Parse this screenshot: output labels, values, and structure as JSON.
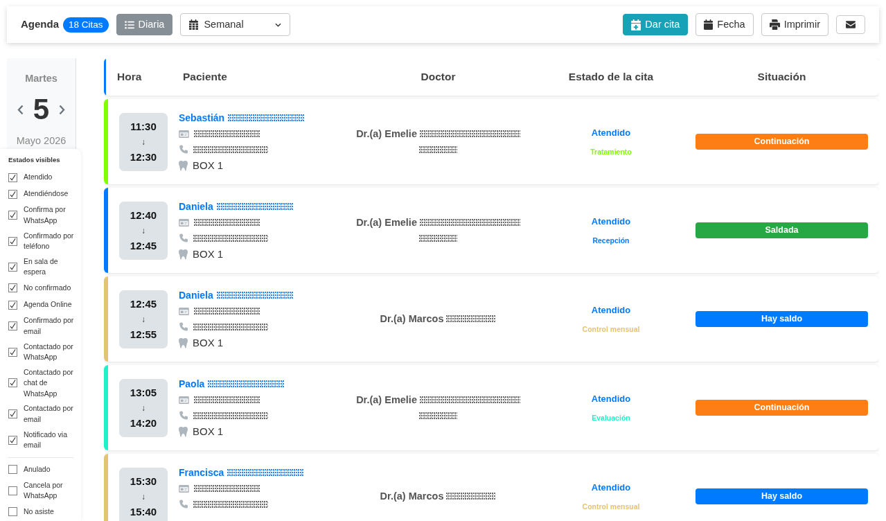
{
  "toolbar": {
    "title": "Agenda",
    "count_badge": "18 Citas",
    "view_button": {
      "label": "Diaria",
      "selected": true
    },
    "view_select": {
      "value": "Semanal"
    },
    "actions": [
      {
        "kind": "add",
        "label": "Dar cita"
      },
      {
        "kind": "date",
        "label": "Fecha"
      },
      {
        "kind": "print",
        "label": "Imprimir"
      },
      {
        "kind": "mail"
      }
    ]
  },
  "date_picker": {
    "weekday": "Martes",
    "day": "5",
    "month_year": "Mayo 2026"
  },
  "status_filter": {
    "title": "Estados visibles",
    "groups": [
      {
        "items": [
          {
            "label": "Atendido",
            "checked": true
          },
          {
            "label": "Atendiéndose",
            "checked": true
          },
          {
            "label": "Confirma por WhatsApp",
            "checked": true
          },
          {
            "label": "Confirmado por teléfono",
            "checked": true
          },
          {
            "label": "En sala de espera",
            "checked": true
          },
          {
            "label": "No confirmado",
            "checked": true
          },
          {
            "label": "Agenda Online",
            "checked": true
          },
          {
            "label": "Confirmado por email",
            "checked": true
          },
          {
            "label": "Contactado por WhatsApp",
            "checked": true
          },
          {
            "label": "Contactado por chat de WhatsApp",
            "checked": true
          },
          {
            "label": "Contactado por email",
            "checked": true
          },
          {
            "label": "Notificado via email",
            "checked": true
          }
        ]
      },
      {
        "items": [
          {
            "label": "Anulado",
            "checked": false
          },
          {
            "label": "Cancela por WhatsApp",
            "checked": false
          },
          {
            "label": "No asiste",
            "checked": false
          }
        ]
      }
    ]
  },
  "table": {
    "columns": [
      "Hora",
      "Paciente",
      "Doctor",
      "Estado de la cita",
      "Situación"
    ],
    "rows": [
      {
        "color": "#7fff00",
        "start": "11:30",
        "arrow": "↓",
        "end": "12:30",
        "patient": "Sebastián",
        "box": "BOX 1",
        "doctor": {
          "kind": "long",
          "name": "Dr.(a) Emelie"
        },
        "status": "Atendido",
        "type": "Tratamiento",
        "situation": {
          "label": "Continuación",
          "color": "#fd7e14"
        }
      },
      {
        "color": "#007bff",
        "start": "12:40",
        "arrow": "↓",
        "end": "12:45",
        "patient": "Daniela",
        "box": "BOX 1",
        "doctor": {
          "kind": "long",
          "name": "Dr.(a) Emelie"
        },
        "status": "Atendido",
        "type": "Recepción",
        "situation": {
          "label": "Saldada",
          "color": "#28a745"
        }
      },
      {
        "color": "#e4c472",
        "start": "12:45",
        "arrow": "↓",
        "end": "12:55",
        "patient": "Daniela",
        "box": "BOX 1",
        "doctor": {
          "kind": "short",
          "name": "Dr.(a) Marcos"
        },
        "status": "Atendido",
        "type": "Control mensual",
        "situation": {
          "label": "Hay saldo",
          "color": "#007bff"
        }
      },
      {
        "color": "#1ef2c8",
        "start": "13:05",
        "arrow": "↓",
        "end": "14:20",
        "patient": "Paola",
        "box": "BOX 1",
        "doctor": {
          "kind": "long",
          "name": "Dr.(a) Emelie"
        },
        "status": "Atendido",
        "type": "Evaluación",
        "situation": {
          "label": "Continuación",
          "color": "#fd7e14"
        }
      },
      {
        "color": "#e4c472",
        "start": "15:30",
        "arrow": "↓",
        "end": "15:40",
        "patient": "Francisca",
        "doctor": {
          "kind": "short",
          "name": "Dr.(a) Marcos"
        },
        "status": "Atendido",
        "type": "Control mensual",
        "situation": {
          "label": "Hay saldo",
          "color": "#007bff"
        }
      }
    ]
  }
}
